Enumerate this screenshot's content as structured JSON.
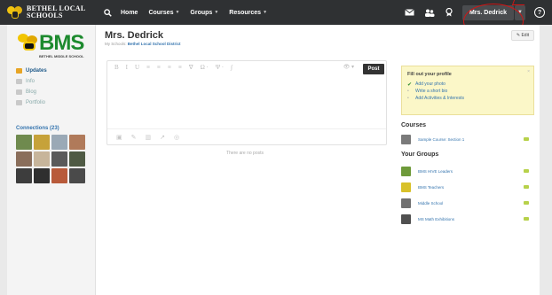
{
  "topbar": {
    "logo_line1": "BETHEL LOCAL",
    "logo_line2": "SCHOOLS",
    "nav": [
      {
        "label": "Home",
        "caret": false
      },
      {
        "label": "Courses",
        "caret": true
      },
      {
        "label": "Groups",
        "caret": true
      },
      {
        "label": "Resources",
        "caret": true
      }
    ],
    "user": "Mrs. Dedrick",
    "help": "?"
  },
  "sidebar": {
    "logo_text": "BMS",
    "logo_sub": "BETHEL MIDDLE SCHOOL",
    "items": [
      {
        "label": "Updates",
        "active": true
      },
      {
        "label": "Info",
        "active": false
      },
      {
        "label": "Blog",
        "active": false
      },
      {
        "label": "Portfolio",
        "active": false
      }
    ],
    "connections_title": "Connections (23)",
    "avatar_colors": [
      "#6f8a4e",
      "#c6a23a",
      "#9aa9b6",
      "#b07a5a",
      "#8a6e5b",
      "#c7b59b",
      "#5a5a5a",
      "#4f5a44",
      "#3d3d3d",
      "#2f2f2f",
      "#b85a3a",
      "#4a4a4a"
    ]
  },
  "main": {
    "name": "Mrs. Dedrick",
    "sub_prefix": "My Schools:",
    "sub_link": "Bethel Local School District",
    "toolbar": [
      "B",
      "I",
      "U",
      "≡",
      "≡",
      "≡",
      "≡",
      "∇",
      "Ω ·",
      "Ψ ·",
      "∫"
    ],
    "bottom_tools": [
      "▣",
      "✎",
      "▥",
      "↗",
      "◎"
    ],
    "post_label": "Post",
    "empty_message": "There are no posts"
  },
  "right": {
    "edit_label": "✎ Edit",
    "profile_box": {
      "title": "Fill out your profile",
      "items": [
        {
          "label": "Add your photo",
          "done": true
        },
        {
          "label": "Write a short bio",
          "done": false
        },
        {
          "label": "Add Activities & Interests",
          "done": false
        }
      ]
    },
    "courses_title": "Courses",
    "courses": [
      {
        "label": "Sample Course: Section 1",
        "color": "#7a7a7a"
      }
    ],
    "groups_title": "Your Groups",
    "groups": [
      {
        "label": "BMS HIVE Leaders",
        "color": "#6e9a3a"
      },
      {
        "label": "BMS Teachers",
        "color": "#d8c12a"
      },
      {
        "label": "Middle School",
        "color": "#707070"
      },
      {
        "label": "MS Math Exhibitions",
        "color": "#505050"
      }
    ]
  }
}
